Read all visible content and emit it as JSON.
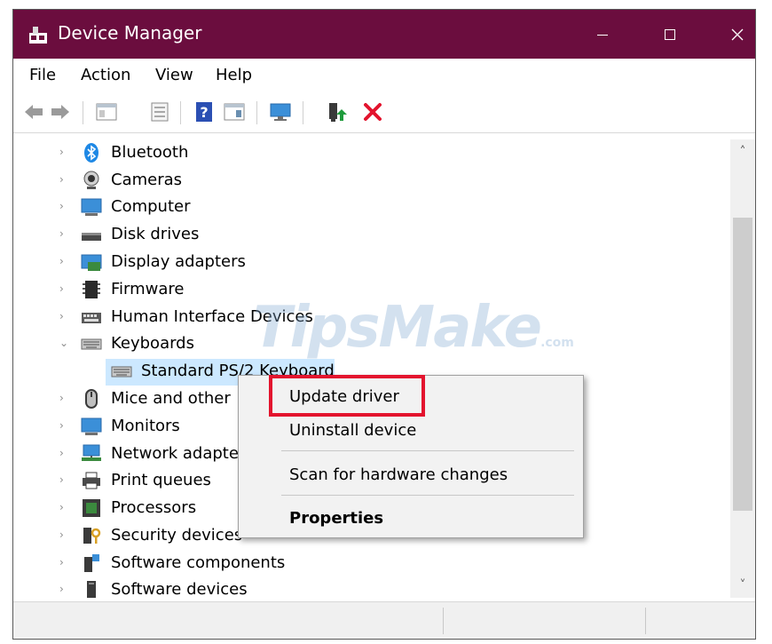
{
  "window": {
    "title": "Device Manager",
    "title_bar_color": "#6b0d3e",
    "controls": [
      "minimize-icon",
      "maximize-icon",
      "close-icon"
    ]
  },
  "menubar": {
    "items": [
      "File",
      "Action",
      "View",
      "Help"
    ]
  },
  "toolbar": {
    "buttons": [
      "back-arrow-icon",
      "forward-arrow-icon",
      "show-hide-console-tree-icon",
      "properties-sheet-icon",
      "help-icon",
      "action-pane-icon",
      "monitor-icon",
      "update-driver-icon",
      "uninstall-device-icon"
    ],
    "uninstall_color": "#e3142e",
    "update_color": "#1f9b3c"
  },
  "tree": {
    "items": [
      {
        "label": "Bluetooth",
        "icon": "bluetooth-icon",
        "expanded": false
      },
      {
        "label": "Cameras",
        "icon": "camera-icon",
        "expanded": false
      },
      {
        "label": "Computer",
        "icon": "computer-icon",
        "expanded": false
      },
      {
        "label": "Disk drives",
        "icon": "disk-drive-icon",
        "expanded": false
      },
      {
        "label": "Display adapters",
        "icon": "display-adapter-icon",
        "expanded": false
      },
      {
        "label": "Firmware",
        "icon": "firmware-icon",
        "expanded": false
      },
      {
        "label": "Human Interface Devices",
        "icon": "hid-icon",
        "expanded": false
      },
      {
        "label": "Keyboards",
        "icon": "keyboard-icon",
        "expanded": true
      },
      {
        "label": "Standard PS/2 Keyboard",
        "icon": "keyboard-icon",
        "child": true,
        "selected": true
      },
      {
        "label": "Mice and other",
        "icon": "mouse-icon",
        "expanded": false
      },
      {
        "label": "Monitors",
        "icon": "monitor-icon",
        "expanded": false
      },
      {
        "label": "Network adapte",
        "icon": "network-adapter-icon",
        "expanded": false
      },
      {
        "label": "Print queues",
        "icon": "printer-icon",
        "expanded": false
      },
      {
        "label": "Processors",
        "icon": "processor-icon",
        "expanded": false
      },
      {
        "label": "Security devices",
        "icon": "security-device-icon",
        "expanded": false
      },
      {
        "label": "Software components",
        "icon": "software-component-icon",
        "expanded": false
      },
      {
        "label": "Software devices",
        "icon": "software-device-icon",
        "expanded": false
      }
    ],
    "selection_color": "#cce8ff"
  },
  "context_menu": {
    "items": [
      {
        "label": "Update driver",
        "bold": false,
        "highlighted": true
      },
      {
        "label": "Uninstall device",
        "bold": false
      },
      {
        "label": "Scan for hardware changes",
        "bold": false
      },
      {
        "label": "Properties",
        "bold": true
      }
    ],
    "highlight_color": "#e3142e"
  },
  "watermark": {
    "text": "TipsMake",
    "suffix": ".com"
  }
}
